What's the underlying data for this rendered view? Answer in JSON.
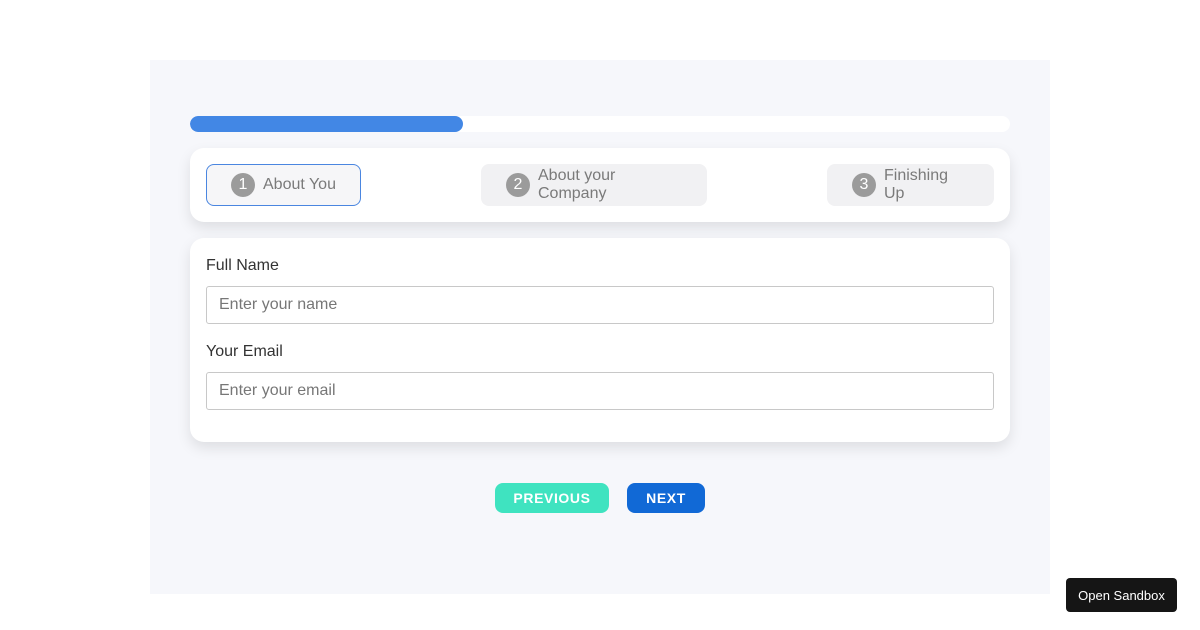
{
  "progress": {
    "fraction": 0.333,
    "fill_color": "#4287e5"
  },
  "steps": [
    {
      "number": "1",
      "label": "About You",
      "active": true
    },
    {
      "number": "2",
      "label": "About your Company",
      "active": false
    },
    {
      "number": "3",
      "label": "Finishing Up",
      "active": false
    }
  ],
  "form": {
    "full_name": {
      "label": "Full Name",
      "placeholder": "Enter your name",
      "value": ""
    },
    "email": {
      "label": "Your Email",
      "placeholder": "Enter your email",
      "value": ""
    }
  },
  "buttons": {
    "previous": {
      "label": "PREVIOUS",
      "color": "#3fe3c0"
    },
    "next": {
      "label": "NEXT",
      "color": "#1169d6"
    }
  },
  "sandbox": {
    "label": "Open Sandbox",
    "color": "#151515"
  }
}
